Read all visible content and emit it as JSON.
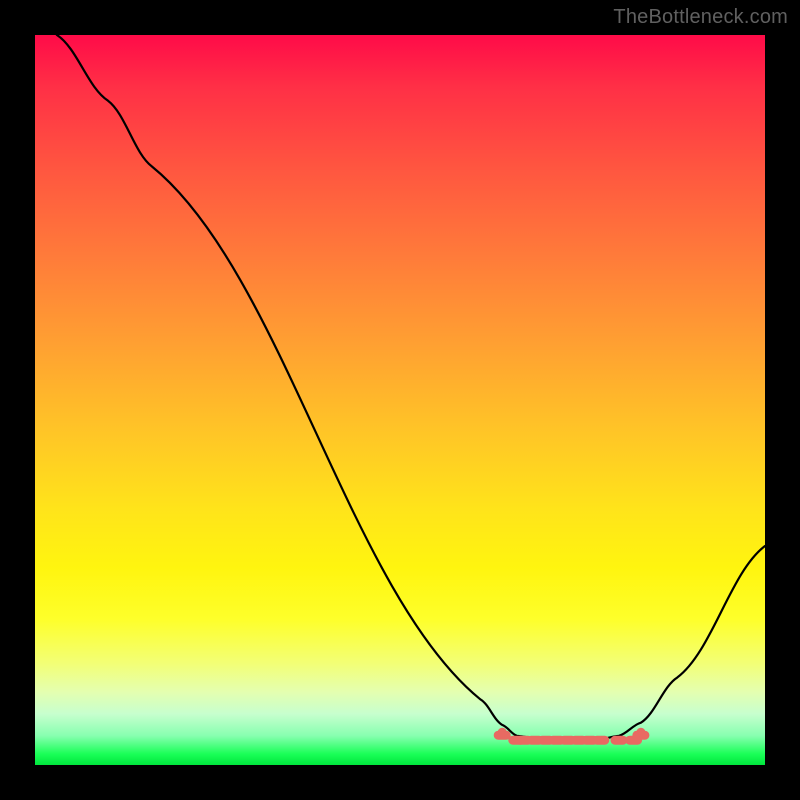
{
  "watermark": "TheBottleneck.com",
  "colors": {
    "background": "#000000",
    "curve": "#000000",
    "trough_marker": "#e86a62",
    "watermark": "#606060",
    "gradient_stops": [
      "#ff0b48",
      "#ff2f46",
      "#ff5540",
      "#ff7a3a",
      "#ff9f32",
      "#ffc427",
      "#ffe41a",
      "#fff50f",
      "#feff2a",
      "#f3ff75",
      "#e4ffb0",
      "#c7ffce",
      "#87ffb0",
      "#1aff57",
      "#00e63d"
    ]
  },
  "chart_data": {
    "type": "line",
    "title": "",
    "xlabel": "",
    "ylabel": "",
    "xlim": [
      0,
      100
    ],
    "ylim": [
      0,
      100
    ],
    "curve": [
      {
        "x": 3,
        "y": 100
      },
      {
        "x": 10,
        "y": 91
      },
      {
        "x": 16,
        "y": 82
      },
      {
        "x": 61,
        "y": 9
      },
      {
        "x": 64,
        "y": 5.5
      },
      {
        "x": 66,
        "y": 4
      },
      {
        "x": 71,
        "y": 3.2
      },
      {
        "x": 76,
        "y": 3.2
      },
      {
        "x": 80,
        "y": 4
      },
      {
        "x": 83,
        "y": 5.8
      },
      {
        "x": 88,
        "y": 12
      },
      {
        "x": 100,
        "y": 30
      }
    ],
    "trough_markers_x": [
      64,
      66,
      67,
      68.5,
      70,
      71.5,
      73,
      74.5,
      76,
      77.5,
      80,
      82,
      83
    ],
    "trough_y": 3.4,
    "trough_range_x": [
      64,
      83
    ]
  }
}
